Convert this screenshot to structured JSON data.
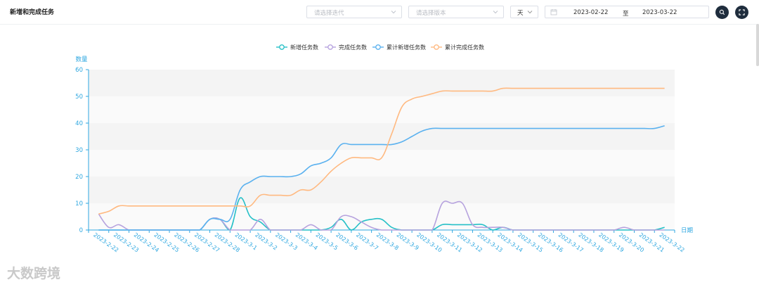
{
  "header": {
    "title": "新增和完成任务",
    "iteration_placeholder": "请选择迭代",
    "version_placeholder": "请选择版本",
    "granularity": "天",
    "date_start": "2023-02-22",
    "date_sep": "至",
    "date_end": "2023-03-22"
  },
  "watermark": "大数跨境",
  "chart_data": {
    "type": "line",
    "ylabel": "数量",
    "xlabel": "日期",
    "ylim": [
      0,
      60
    ],
    "yticks": [
      0,
      10,
      20,
      30,
      40,
      50,
      60
    ],
    "legend_position": "top-center",
    "grid": "horizontal bands",
    "categories": [
      "2023-2-22",
      "2023-2-23",
      "2023-2-24",
      "2023-2-25",
      "2023-2-26",
      "2023-2-27",
      "2023-2-28",
      "2023-3-1",
      "2023-3-2",
      "2023-3-3",
      "2023-3-4",
      "2023-3-5",
      "2023-3-6",
      "2023-3-7",
      "2023-3-8",
      "2023-3-9",
      "2023-3-10",
      "2023-3-11",
      "2023-3-12",
      "2023-3-13",
      "2023-3-14",
      "2023-3-15",
      "2023-3-16",
      "2023-3-17",
      "2023-3-18",
      "2023-3-19",
      "2023-3-20",
      "2023-3-21",
      "2023-3-22"
    ],
    "x": [
      0,
      0.5,
      1,
      1.5,
      2,
      2.5,
      3,
      3.5,
      4,
      4.5,
      5,
      5.5,
      6,
      6.5,
      7,
      7.5,
      8,
      8.5,
      9,
      9.5,
      10,
      10.5,
      11,
      11.5,
      12,
      12.5,
      13,
      13.5,
      14,
      14.5,
      15,
      15.5,
      16,
      16.5,
      17,
      17.5,
      18,
      18.5,
      19,
      19.5,
      20,
      20.5,
      21,
      21.5,
      22,
      22.5,
      23,
      23.5,
      24,
      24.5,
      25,
      25.5,
      26,
      26.5,
      27,
      27.5,
      28
    ],
    "series": [
      {
        "name": "新增任务数",
        "color": "#26c0c7",
        "values": [
          0,
          0,
          0,
          0,
          0,
          0,
          0,
          0,
          0,
          0,
          0,
          4,
          4,
          0,
          12,
          5,
          3,
          0,
          0,
          0,
          0,
          0,
          0,
          1,
          4,
          0,
          3,
          4,
          4,
          1,
          0,
          0,
          0,
          0,
          2,
          2,
          2,
          2,
          2,
          0,
          1,
          0,
          0,
          0,
          0,
          0,
          0,
          0,
          0,
          0,
          0,
          0,
          0,
          0,
          0,
          0,
          1
        ]
      },
      {
        "name": "完成任务数",
        "color": "#b6a2de",
        "values": [
          6,
          1,
          2,
          0,
          0,
          0,
          0,
          0,
          0,
          0,
          0,
          4,
          4,
          0,
          0,
          0,
          4,
          0,
          0,
          0,
          0,
          2,
          0,
          0,
          5,
          5,
          3,
          1,
          0,
          0,
          0,
          0,
          0,
          0,
          10,
          10,
          10,
          2,
          1,
          1,
          1,
          0,
          0,
          0,
          0,
          0,
          0,
          0,
          0,
          0,
          0,
          0,
          1,
          0,
          0,
          0,
          0
        ]
      },
      {
        "name": "累计新增任务数",
        "color": "#5ab1ef",
        "values": [
          0,
          0,
          0,
          0,
          0,
          0,
          0,
          0,
          0,
          0,
          0,
          4,
          4,
          4,
          15,
          18,
          20,
          20,
          20,
          20,
          21,
          24,
          25,
          27,
          32,
          32,
          32,
          32,
          32,
          32,
          33,
          35,
          37,
          38,
          38,
          38,
          38,
          38,
          38,
          38,
          38,
          38,
          38,
          38,
          38,
          38,
          38,
          38,
          38,
          38,
          38,
          38,
          38,
          38,
          38,
          38,
          39
        ]
      },
      {
        "name": "累计完成任务数",
        "color": "#ffb980",
        "values": [
          6,
          7,
          9,
          9,
          9,
          9,
          9,
          9,
          9,
          9,
          9,
          9,
          9,
          9,
          9,
          9,
          13,
          13,
          13,
          13,
          15,
          15,
          18,
          22,
          25,
          27,
          27,
          27,
          27,
          36,
          46,
          49,
          50,
          51,
          52,
          52,
          52,
          52,
          52,
          52,
          53,
          53,
          53,
          53,
          53,
          53,
          53,
          53,
          53,
          53,
          53,
          53,
          53,
          53,
          53,
          53,
          53
        ]
      }
    ]
  }
}
